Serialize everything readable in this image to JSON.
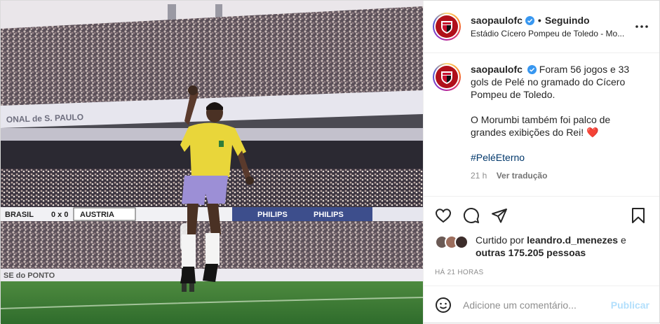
{
  "post": {
    "username": "saopaulofc",
    "follow_status": "Seguindo",
    "location": "Estádio Cícero Pompeu de Toledo - Mo...",
    "caption": {
      "paragraph1": "Foram 56 jogos e 33 gols de Pelé no gramado do Cícero Pompeu de Toledo.",
      "paragraph2": "O Morumbi também foi palco de grandes exibições do Rei!",
      "heart": "❤️",
      "hashtag": "#PeléEterno",
      "age": "21 h",
      "translate": "Ver tradução"
    },
    "likes": {
      "prefix": "Curtido por",
      "user": "leandro.d_menezes",
      "and": "e",
      "others": "outras 175.205 pessoas"
    },
    "timestamp": "HÁ 21 HORAS",
    "comment": {
      "placeholder": "Adicione um comentário...",
      "post_label": "Publicar"
    }
  },
  "photo": {
    "boards": {
      "brasil": "BRASIL",
      "score": "0 x 0",
      "austria": "AUSTRIA",
      "philips1": "PHILIPS",
      "philips2": "PHILIPS",
      "banner_top": "ONAL de S. PAULO",
      "banner_bottom": "SE do PONTO"
    }
  },
  "colors": {
    "accent_blue": "#0095f6",
    "verified_blue": "#3897f0",
    "brand_red": "#b0101a",
    "jersey_yellow": "#e9d63a",
    "shorts_lilac": "#9c8fd6"
  },
  "icons": [
    "verified-icon",
    "more-icon",
    "heart-icon",
    "comment-icon",
    "share-icon",
    "save-icon",
    "emoji-icon"
  ]
}
